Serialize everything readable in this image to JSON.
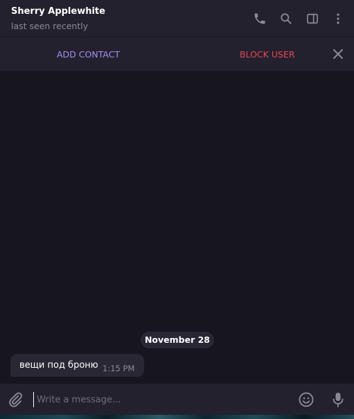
{
  "header": {
    "contact_name": "Sherry Applewhite",
    "status": "last seen recently",
    "icons": [
      "phone-icon",
      "search-icon",
      "sidebar-toggle-icon",
      "more-vertical-icon"
    ]
  },
  "action_bar": {
    "add_contact_label": "ADD CONTACT",
    "block_user_label": "BLOCK USER",
    "close_icon": "close-icon"
  },
  "chat": {
    "date_label": "November 28",
    "messages": [
      {
        "text": "вещи под броню",
        "time": "1:15 PM",
        "direction": "incoming"
      }
    ]
  },
  "composer": {
    "placeholder": "Write a message...",
    "value": "",
    "icons": [
      "attach-icon",
      "emoji-icon",
      "microphone-icon"
    ]
  },
  "colors": {
    "background": "#17151f",
    "bar": "#24212f",
    "bubble": "#2a2735",
    "accent": "#a58ff0",
    "danger": "#e8454f",
    "muted_text": "#8b8998"
  }
}
